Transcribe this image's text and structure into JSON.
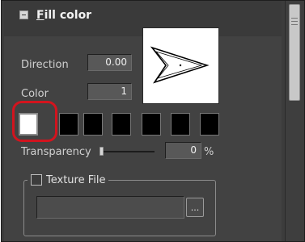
{
  "fill_section": {
    "title_first_letter": "F",
    "title_rest": "ill color"
  },
  "direction": {
    "label": "Direction",
    "value": "0.00"
  },
  "color": {
    "label": "Color",
    "value": "1",
    "swatches": [
      "#ffffff",
      "#000000",
      "#000000",
      "#000000",
      "#000000",
      "#000000",
      "#000000"
    ],
    "selected_index": 0
  },
  "transparency": {
    "label": "Transparency",
    "value": "0",
    "unit": "%",
    "level": 0
  },
  "texture": {
    "label": "Texture File",
    "file_value": "",
    "browse_label": "..."
  },
  "colors": {
    "highlight": "#d2141e",
    "panel": "#424242"
  }
}
